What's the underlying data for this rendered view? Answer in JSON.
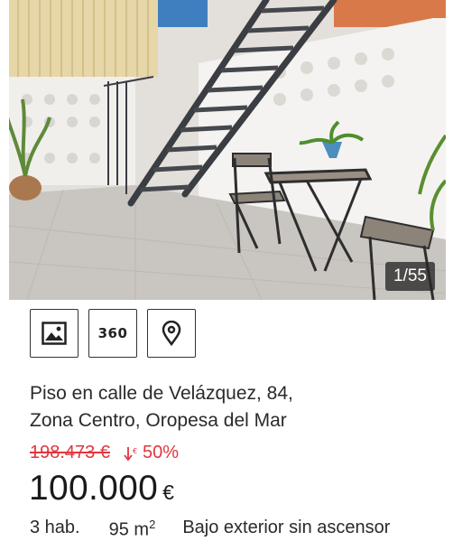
{
  "listing": {
    "photo_counter": "1/55",
    "title_line1": "Piso en calle de Velázquez, 84,",
    "title_line2": "Zona Centro, Oropesa del Mar",
    "old_price": "198.473 €",
    "discount": "50%",
    "price_amount": "100.000",
    "price_currency": "€",
    "features": {
      "rooms": "3 hab.",
      "area_value": "95 m",
      "area_unit_sup": "2",
      "floor": "Bajo exterior sin ascensor"
    }
  },
  "media_buttons": {
    "photos_icon": "image-icon",
    "tour_label": "360",
    "map_icon": "map-pin-icon"
  },
  "colors": {
    "discount_red": "#e0363f",
    "text_dark": "#222222"
  }
}
